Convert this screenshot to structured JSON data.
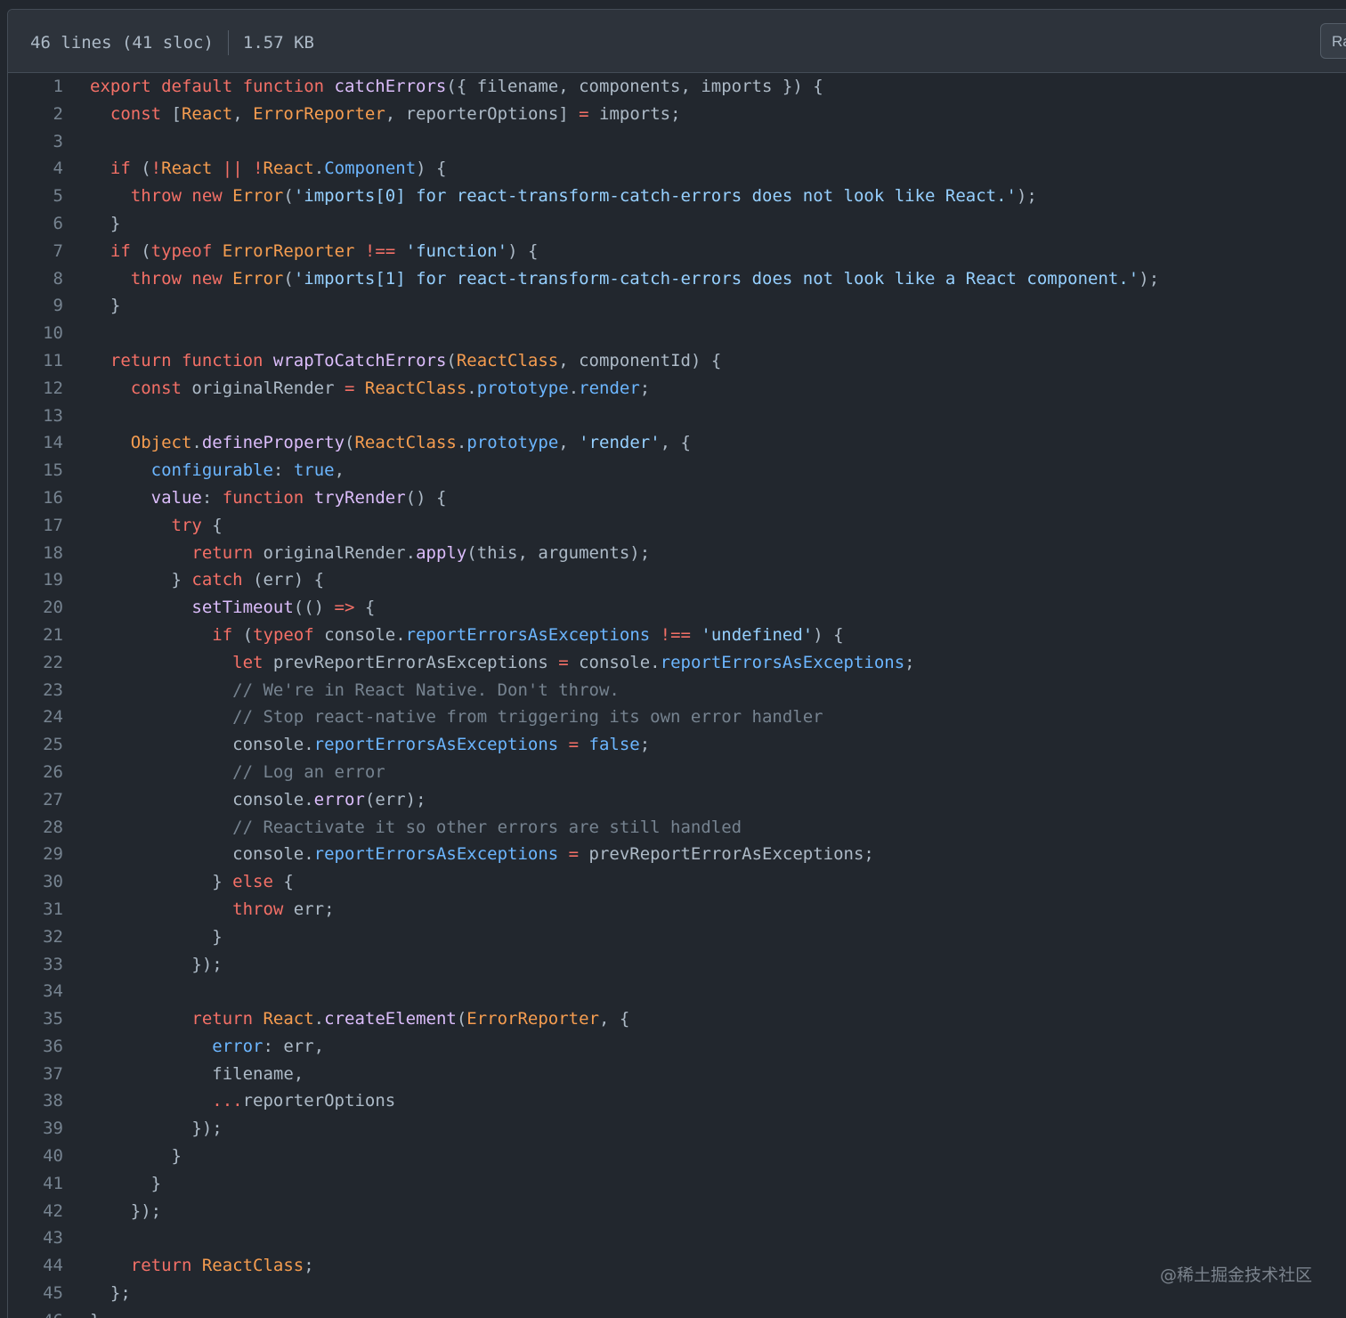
{
  "header": {
    "lines_info": "46 lines (41 sloc)",
    "size_info": "1.57 KB",
    "raw_button_label": "Raw"
  },
  "code": {
    "lines": [
      [
        [
          "k",
          "export default function "
        ],
        [
          "f",
          "catchErrors"
        ],
        [
          "",
          "({ filename, components, imports }) {"
        ]
      ],
      [
        [
          "",
          "  "
        ],
        [
          "k",
          "const "
        ],
        [
          "",
          "["
        ],
        [
          "t",
          "React"
        ],
        [
          "",
          ", "
        ],
        [
          "t",
          "ErrorReporter"
        ],
        [
          "",
          ", reporterOptions] "
        ],
        [
          "k",
          "="
        ],
        [
          "",
          " imports;"
        ]
      ],
      [
        [
          "",
          ""
        ]
      ],
      [
        [
          "",
          "  "
        ],
        [
          "k",
          "if "
        ],
        [
          "",
          "("
        ],
        [
          "k",
          "!"
        ],
        [
          "t",
          "React "
        ],
        [
          "k",
          "|| !"
        ],
        [
          "t",
          "React"
        ],
        [
          "",
          "."
        ],
        [
          "p",
          "Component"
        ],
        [
          "",
          ") {"
        ]
      ],
      [
        [
          "",
          "    "
        ],
        [
          "k",
          "throw new "
        ],
        [
          "t",
          "Error"
        ],
        [
          "",
          "("
        ],
        [
          "s",
          "'imports[0] for react-transform-catch-errors does not look like React.'"
        ],
        [
          "",
          ");"
        ]
      ],
      [
        [
          "",
          "  }"
        ]
      ],
      [
        [
          "",
          "  "
        ],
        [
          "k",
          "if "
        ],
        [
          "",
          "("
        ],
        [
          "k",
          "typeof "
        ],
        [
          "t",
          "ErrorReporter "
        ],
        [
          "k",
          "!== "
        ],
        [
          "s",
          "'function'"
        ],
        [
          "",
          ") {"
        ]
      ],
      [
        [
          "",
          "    "
        ],
        [
          "k",
          "throw new "
        ],
        [
          "t",
          "Error"
        ],
        [
          "",
          "("
        ],
        [
          "s",
          "'imports[1] for react-transform-catch-errors does not look like a React component.'"
        ],
        [
          "",
          ");"
        ]
      ],
      [
        [
          "",
          "  }"
        ]
      ],
      [
        [
          "",
          ""
        ]
      ],
      [
        [
          "",
          "  "
        ],
        [
          "k",
          "return function "
        ],
        [
          "f",
          "wrapToCatchErrors"
        ],
        [
          "",
          "("
        ],
        [
          "t",
          "ReactClass"
        ],
        [
          "",
          ", componentId) {"
        ]
      ],
      [
        [
          "",
          "    "
        ],
        [
          "k",
          "const "
        ],
        [
          "",
          "originalRender "
        ],
        [
          "k",
          "= "
        ],
        [
          "t",
          "ReactClass"
        ],
        [
          "",
          "."
        ],
        [
          "p",
          "prototype"
        ],
        [
          "",
          "."
        ],
        [
          "p",
          "render"
        ],
        [
          "",
          ";"
        ]
      ],
      [
        [
          "",
          ""
        ]
      ],
      [
        [
          "",
          "    "
        ],
        [
          "t",
          "Object"
        ],
        [
          "",
          "."
        ],
        [
          "f",
          "defineProperty"
        ],
        [
          "",
          "("
        ],
        [
          "t",
          "ReactClass"
        ],
        [
          "",
          "."
        ],
        [
          "p",
          "prototype"
        ],
        [
          "",
          ", "
        ],
        [
          "s",
          "'render'"
        ],
        [
          "",
          ", {"
        ]
      ],
      [
        [
          "",
          "      "
        ],
        [
          "p",
          "configurable"
        ],
        [
          "",
          ": "
        ],
        [
          "p",
          "true"
        ],
        [
          "",
          ","
        ]
      ],
      [
        [
          "",
          "      "
        ],
        [
          "f",
          "value"
        ],
        [
          "",
          ": "
        ],
        [
          "k",
          "function "
        ],
        [
          "f",
          "tryRender"
        ],
        [
          "",
          "() {"
        ]
      ],
      [
        [
          "",
          "        "
        ],
        [
          "k",
          "try "
        ],
        [
          "",
          "{"
        ]
      ],
      [
        [
          "",
          "          "
        ],
        [
          "k",
          "return "
        ],
        [
          "",
          "originalRender."
        ],
        [
          "f",
          "apply"
        ],
        [
          "",
          "(this, arguments);"
        ]
      ],
      [
        [
          "",
          "        } "
        ],
        [
          "k",
          "catch "
        ],
        [
          "",
          "(err) {"
        ]
      ],
      [
        [
          "",
          "          "
        ],
        [
          "f",
          "setTimeout"
        ],
        [
          "",
          "(() "
        ],
        [
          "k",
          "=> "
        ],
        [
          "",
          "{"
        ]
      ],
      [
        [
          "",
          "            "
        ],
        [
          "k",
          "if "
        ],
        [
          "",
          "("
        ],
        [
          "k",
          "typeof "
        ],
        [
          "",
          "console."
        ],
        [
          "p",
          "reportErrorsAsExceptions "
        ],
        [
          "k",
          "!== "
        ],
        [
          "s",
          "'undefined'"
        ],
        [
          "",
          ") {"
        ]
      ],
      [
        [
          "",
          "              "
        ],
        [
          "k",
          "let "
        ],
        [
          "",
          "prevReportErrorAsExceptions "
        ],
        [
          "k",
          "= "
        ],
        [
          "",
          "console."
        ],
        [
          "p",
          "reportErrorsAsExceptions"
        ],
        [
          "",
          ";"
        ]
      ],
      [
        [
          "",
          "              "
        ],
        [
          "c",
          "// We're in React Native. Don't throw."
        ]
      ],
      [
        [
          "",
          "              "
        ],
        [
          "c",
          "// Stop react-native from triggering its own error handler"
        ]
      ],
      [
        [
          "",
          "              console."
        ],
        [
          "p",
          "reportErrorsAsExceptions "
        ],
        [
          "k",
          "= "
        ],
        [
          "p",
          "false"
        ],
        [
          "",
          ";"
        ]
      ],
      [
        [
          "",
          "              "
        ],
        [
          "c",
          "// Log an error"
        ]
      ],
      [
        [
          "",
          "              console."
        ],
        [
          "f",
          "error"
        ],
        [
          "",
          "(err);"
        ]
      ],
      [
        [
          "",
          "              "
        ],
        [
          "c",
          "// Reactivate it so other errors are still handled"
        ]
      ],
      [
        [
          "",
          "              console."
        ],
        [
          "p",
          "reportErrorsAsExceptions "
        ],
        [
          "k",
          "= "
        ],
        [
          "",
          "prevReportErrorAsExceptions;"
        ]
      ],
      [
        [
          "",
          "            } "
        ],
        [
          "k",
          "else "
        ],
        [
          "",
          "{"
        ]
      ],
      [
        [
          "",
          "              "
        ],
        [
          "k",
          "throw "
        ],
        [
          "",
          "err;"
        ]
      ],
      [
        [
          "",
          "            }"
        ]
      ],
      [
        [
          "",
          "          });"
        ]
      ],
      [
        [
          "",
          ""
        ]
      ],
      [
        [
          "",
          "          "
        ],
        [
          "k",
          "return "
        ],
        [
          "t",
          "React"
        ],
        [
          "",
          "."
        ],
        [
          "f",
          "createElement"
        ],
        [
          "",
          "("
        ],
        [
          "t",
          "ErrorReporter"
        ],
        [
          "",
          ", {"
        ]
      ],
      [
        [
          "",
          "            "
        ],
        [
          "p",
          "error"
        ],
        [
          "",
          ": err,"
        ]
      ],
      [
        [
          "",
          "            filename,"
        ]
      ],
      [
        [
          "",
          "            "
        ],
        [
          "k",
          "..."
        ],
        [
          "",
          "reporterOptions"
        ]
      ],
      [
        [
          "",
          "          });"
        ]
      ],
      [
        [
          "",
          "        }"
        ]
      ],
      [
        [
          "",
          "      }"
        ]
      ],
      [
        [
          "",
          "    });"
        ]
      ],
      [
        [
          "",
          ""
        ]
      ],
      [
        [
          "",
          "    "
        ],
        [
          "k",
          "return "
        ],
        [
          "t",
          "ReactClass"
        ],
        [
          "",
          ";"
        ]
      ],
      [
        [
          "",
          "  };"
        ]
      ],
      [
        [
          "",
          "}"
        ]
      ]
    ]
  },
  "watermark": "@稀土掘金技术社区",
  "colors": {
    "background": "#22272e",
    "header_background": "#2d333b",
    "keyword": "#f47067",
    "function": "#dcbdfb",
    "string": "#96d0ff",
    "comment": "#768390",
    "property": "#6cb6ff",
    "type": "#f69d50"
  }
}
